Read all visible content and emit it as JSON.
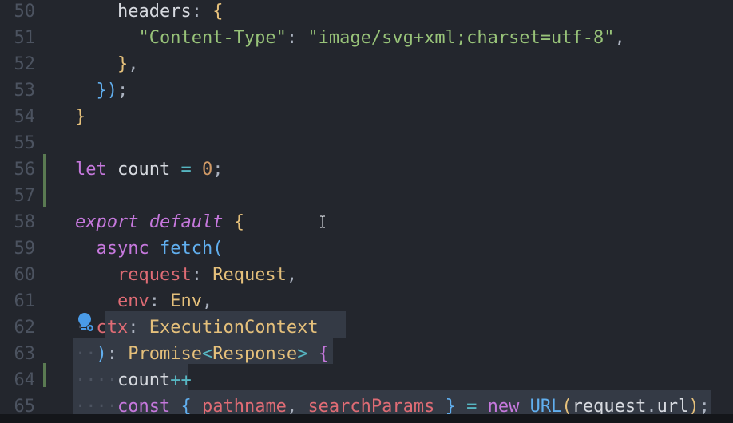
{
  "editor": {
    "lines": [
      {
        "number": "50",
        "tokens": [
          [
            "tok-plain",
            "    headers"
          ],
          [
            "tok-punc",
            ": "
          ],
          [
            "tok-brace1",
            "{"
          ]
        ]
      },
      {
        "number": "51",
        "tokens": [
          [
            "tok-string",
            "      \"Content-Type\""
          ],
          [
            "tok-punc",
            ": "
          ],
          [
            "tok-string",
            "\"image/svg+xml;charset=utf-8\""
          ],
          [
            "tok-punc",
            ","
          ]
        ]
      },
      {
        "number": "52",
        "tokens": [
          [
            "tok-brace1",
            "    }"
          ],
          [
            "tok-punc",
            ","
          ]
        ]
      },
      {
        "number": "53",
        "tokens": [
          [
            "tok-brace2",
            "  })"
          ],
          [
            "tok-punc",
            ";"
          ]
        ]
      },
      {
        "number": "54",
        "tokens": [
          [
            "tok-brace1",
            "}"
          ]
        ]
      },
      {
        "number": "55",
        "tokens": []
      },
      {
        "number": "56",
        "tokens": [
          [
            "tok-keyword",
            "let "
          ],
          [
            "tok-plain",
            "count "
          ],
          [
            "tok-op",
            "= "
          ],
          [
            "tok-num",
            "0"
          ],
          [
            "tok-punc",
            ";"
          ]
        ]
      },
      {
        "number": "57",
        "tokens": []
      },
      {
        "number": "58",
        "tokens": [
          [
            "tok-keyword-it",
            "export default "
          ],
          [
            "tok-brace1",
            "{"
          ]
        ]
      },
      {
        "number": "59",
        "tokens": [
          [
            "tok-keyword",
            "  async "
          ],
          [
            "tok-fn",
            "fetch"
          ],
          [
            "tok-brace2",
            "("
          ]
        ]
      },
      {
        "number": "60",
        "tokens": [
          [
            "tok-prop",
            "    request"
          ],
          [
            "tok-punc",
            ": "
          ],
          [
            "tok-type",
            "Request"
          ],
          [
            "tok-punc",
            ","
          ]
        ]
      },
      {
        "number": "61",
        "tokens": [
          [
            "tok-prop",
            "    env"
          ],
          [
            "tok-punc",
            ": "
          ],
          [
            "tok-type",
            "Env"
          ],
          [
            "tok-punc",
            ","
          ]
        ]
      },
      {
        "number": "62",
        "tokens": [
          [
            "tok-ws",
            "··"
          ],
          [
            "tok-prop",
            "ctx"
          ],
          [
            "tok-punc",
            ": "
          ],
          [
            "tok-type",
            "ExecutionContext"
          ]
        ]
      },
      {
        "number": "63",
        "tokens": [
          [
            "tok-ws",
            "··"
          ],
          [
            "tok-brace2",
            ")"
          ],
          [
            "tok-punc",
            ": "
          ],
          [
            "tok-type",
            "Promise"
          ],
          [
            "tok-op",
            "<"
          ],
          [
            "tok-type",
            "Response"
          ],
          [
            "tok-op",
            "> "
          ],
          [
            "tok-keyword",
            "{"
          ]
        ]
      },
      {
        "number": "64",
        "tokens": [
          [
            "tok-ws",
            "····"
          ],
          [
            "tok-plain",
            "count"
          ],
          [
            "tok-op",
            "++"
          ]
        ]
      },
      {
        "number": "65",
        "tokens": [
          [
            "tok-ws",
            "····"
          ],
          [
            "tok-keyword",
            "const "
          ],
          [
            "tok-fn",
            "{ "
          ],
          [
            "tok-prop",
            "pathname"
          ],
          [
            "tok-punc",
            ", "
          ],
          [
            "tok-prop",
            "searchParams "
          ],
          [
            "tok-fn",
            "} "
          ],
          [
            "tok-op",
            "= "
          ],
          [
            "tok-keyword",
            "new "
          ],
          [
            "tok-fn",
            "URL"
          ],
          [
            "tok-brace1",
            "("
          ],
          [
            "tok-plain",
            "request"
          ],
          [
            "tok-punc",
            "."
          ],
          [
            "tok-plain",
            "url"
          ],
          [
            "tok-brace1",
            ")"
          ],
          [
            "tok-punc",
            ";"
          ]
        ]
      }
    ]
  },
  "icons": {
    "lightbulb": "lightbulb-icon",
    "text_cursor": "i-beam-cursor-icon"
  }
}
